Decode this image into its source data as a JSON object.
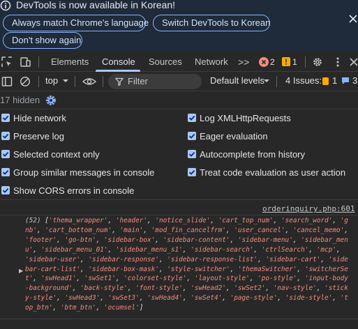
{
  "infobar": {
    "message": "DevTools is now available in Korean!",
    "btn_match": "Always match Chrome's language",
    "btn_switch": "Switch DevTools to Korean",
    "btn_dont": "Don't show again"
  },
  "tabs": {
    "elements": "Elements",
    "console": "Console",
    "sources": "Sources",
    "network": "Network",
    "more": ">>",
    "errors": "2",
    "warnings": "1"
  },
  "toolbar": {
    "context": "top",
    "filter_placeholder": "Filter",
    "levels": "Default levels",
    "issues_label": "4 Issues:",
    "issues_warn": "1",
    "issues_info": "3"
  },
  "hidden": {
    "text": "17 hidden"
  },
  "settings": {
    "left": [
      "Hide network",
      "Preserve log",
      "Selected context only",
      "Group similar messages in console",
      "Show CORS errors in console"
    ],
    "right": [
      "Log XMLHttpRequests",
      "Eager evaluation",
      "Autocomplete from history",
      "Treat code evaluation as user action"
    ]
  },
  "console": {
    "source": "orderinquiry.php:601",
    "count": "(52)",
    "items": [
      "thema_wrapper",
      "header",
      "notice_slide",
      "cart_top_num",
      "search_word",
      "gnb",
      "cart_bottom_num",
      "main",
      "mod_fin_cancelfrm",
      "user_cancel",
      "cancel_memo",
      "footer",
      "go-btn",
      "sidebar-box",
      "sidebar-content",
      "sidebar-menu",
      "sidebar_menu",
      "sidebar_menu_01",
      "sidebar_menu_s1",
      "sidebar-search",
      "ctrlSearch",
      "mcp",
      "sidebar-user",
      "sidebar-response",
      "sidebar-response-list",
      "sidebar-cart",
      "sidebar-cart-list",
      "sidebar-box-mask",
      "style-switcher",
      "themaSwitcher",
      "switcherSet",
      "swHead1",
      "swSet1",
      "colorset-style",
      "layout-style",
      "po-style",
      "input-body-background",
      "back-style",
      "font-style",
      "swHead2",
      "swSet2",
      "nav-style",
      "sticky-style",
      "swHead3",
      "swSet3",
      "swHead4",
      "swSet4",
      "page-style",
      "side-style",
      "top_btn",
      "btm_btn",
      "ocumsel"
    ]
  }
}
